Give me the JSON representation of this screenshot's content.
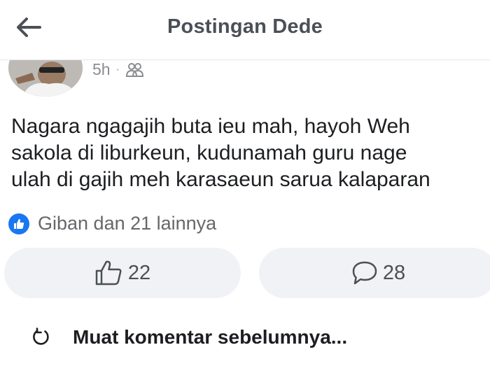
{
  "header": {
    "title": "Postingan Dede",
    "back_icon": "arrow-left-icon"
  },
  "post": {
    "time": "5h",
    "separator": "·",
    "audience_icon": "friends-icon",
    "text": "Nagara ngagajih buta ieu mah, hayoh Weh\nsakola di liburkeun, kudunamah guru nage\nulah di gajih meh karasaeun sarua kalaparan",
    "reactions_summary": "Giban dan 21 lainnya",
    "reaction_icon": "like-badge-icon"
  },
  "actions": {
    "like_count": "22",
    "comment_count": "28"
  },
  "comments": {
    "load_more_label": "Muat komentar sebelumnya..."
  },
  "colors": {
    "brand_blue": "#1877f2",
    "button_bg": "#f0f2f5",
    "text_dark": "#1c1e21",
    "text_muted": "#65676b"
  }
}
